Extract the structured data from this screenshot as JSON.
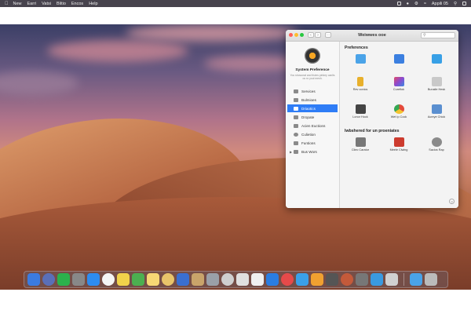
{
  "menubar": {
    "items": [
      "New",
      "Earri",
      "Vatsi",
      "Blitio",
      "Encos",
      "Help"
    ],
    "clock": "Appili 05"
  },
  "window": {
    "title": "Weiwwes ooe",
    "sidebar": {
      "app_name": "System Preference",
      "description": "You showorat and frutes pinbey canlls ou ro youl mesh.",
      "items": [
        {
          "label": "Services",
          "selected": false,
          "icon": "gear-icon"
        },
        {
          "label": "Bulmioes",
          "selected": false,
          "icon": "grid-icon"
        },
        {
          "label": "Driaotics",
          "selected": true,
          "icon": "folder-icon"
        },
        {
          "label": "Dropate",
          "selected": false,
          "icon": "download-icon"
        },
        {
          "label": "Acien Euctions",
          "selected": false,
          "icon": "list-icon"
        },
        {
          "label": "Culietion",
          "selected": false,
          "icon": "circle-icon"
        },
        {
          "label": "Funtions",
          "selected": false,
          "icon": "function-icon"
        },
        {
          "label": "Bus Wors",
          "selected": false,
          "icon": "bus-icon"
        }
      ]
    },
    "content": {
      "section1_title": "Preferences",
      "section2_title": "Iwbshered for un proeniates",
      "prefs": [
        {
          "label": "",
          "icon": "blue-folder-icon",
          "color": "#4aa3e8"
        },
        {
          "label": "",
          "icon": "monitor-icon",
          "color": "#3b7fe0"
        },
        {
          "label": "",
          "icon": "cloud-folder-icon",
          "color": "#38a0e6"
        },
        {
          "label": "Rev conics",
          "icon": "pencil-icon",
          "color": "#e8b02c"
        },
        {
          "label": "Cureflok",
          "icon": "color-grid-icon",
          "color": "#d0506a"
        },
        {
          "label": "Bunaile Hesk",
          "icon": "gray-folder-icon",
          "color": "#c9c9c9"
        },
        {
          "label": "Lonor Hock",
          "icon": "terminal-icon",
          "color": "#444444"
        },
        {
          "label": "Wet Ip Cock",
          "icon": "chrome-icon",
          "color": "#e34a3a"
        },
        {
          "label": "Acreye Chick",
          "icon": "network-icon",
          "color": "#5a8fd0"
        }
      ],
      "others": [
        {
          "label": "Cliec Carator",
          "icon": "camera-icon",
          "color": "#777777"
        },
        {
          "label": "Meele Clwlng",
          "icon": "burst-icon",
          "color": "#cc3b2e"
        },
        {
          "label": "Sacios Rap",
          "icon": "gear-gray-icon",
          "color": "#8a8a8a"
        }
      ]
    }
  },
  "dock": {
    "colors": [
      "#3b7be0",
      "#5a6fb8",
      "#2bb24c",
      "#888888",
      "#2d8cf0",
      "#f5f5f5",
      "#f1d24a",
      "#4caf50",
      "#f7d774",
      "#e8c46a",
      "#3a6fd0",
      "#c9a46a",
      "#9aa0a8",
      "#cfcfcf",
      "#e0e0e0",
      "#f0f0f0",
      "#2a7de1",
      "#e64a4a",
      "#3aa0e8",
      "#f0a030",
      "#555555",
      "#c45a3a",
      "#777777",
      "#3a9ae0",
      "#d0d0d0"
    ],
    "extra_colors": [
      "#4aa3e8",
      "#bbbbbb"
    ]
  }
}
